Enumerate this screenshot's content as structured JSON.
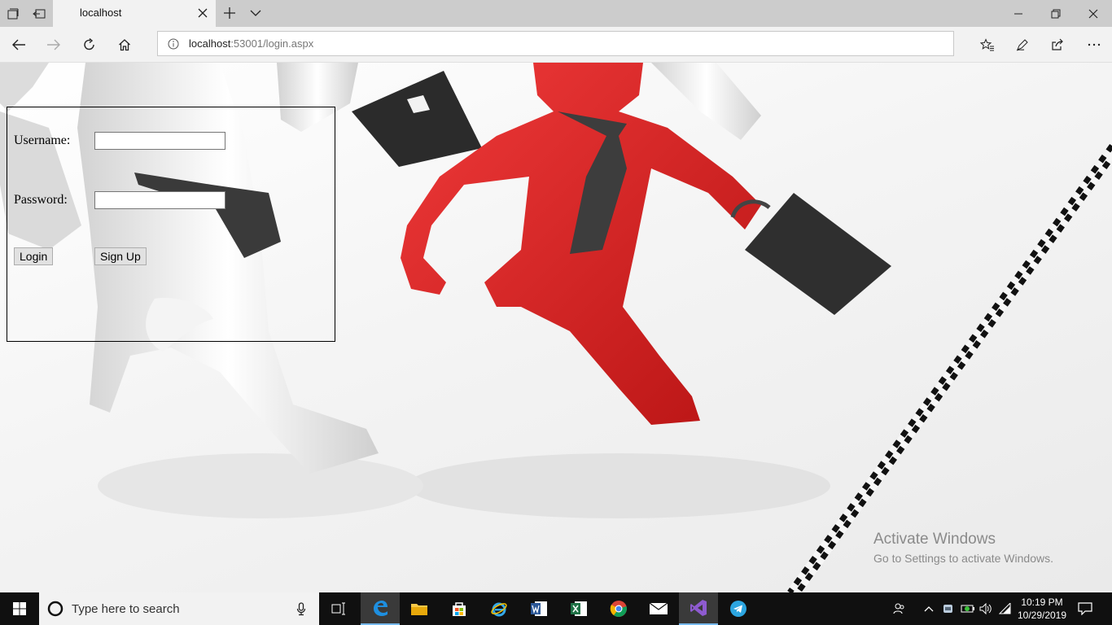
{
  "browser": {
    "tab_title": "localhost",
    "address_host": "localhost",
    "address_rest": ":53001/login.aspx"
  },
  "login": {
    "username_label": "Username:",
    "username_value": "",
    "password_label": "Password:",
    "password_value": "",
    "login_button": "Login",
    "signup_button": "Sign Up"
  },
  "watermark": {
    "line1": "Activate Windows",
    "line2": "Go to Settings to activate Windows."
  },
  "taskbar": {
    "search_placeholder": "Type here to search",
    "apps": [
      "task-view",
      "edge",
      "file-explorer",
      "store",
      "internet-explorer",
      "word",
      "excel",
      "chrome",
      "mail",
      "visual-studio",
      "telegram"
    ],
    "time": "10:19 PM",
    "date": "10/29/2019"
  },
  "colors": {
    "accent_red": "#e02626",
    "taskbar": "#101010",
    "chrome_bg": "#f2f2f2"
  }
}
